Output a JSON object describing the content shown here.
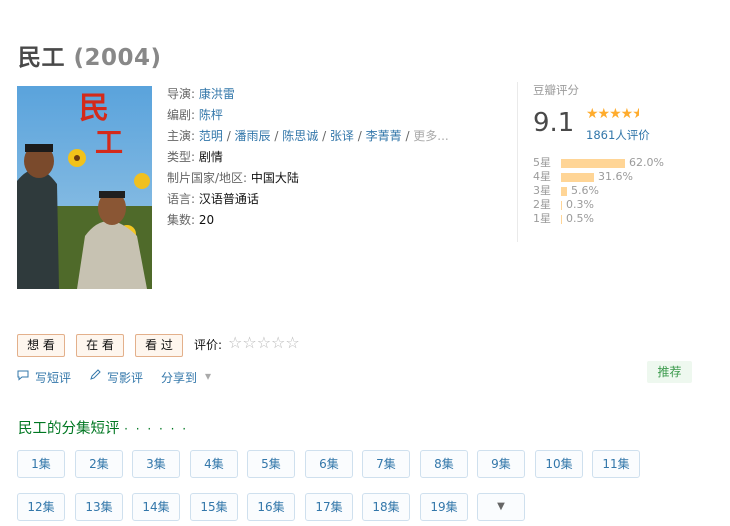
{
  "title": {
    "name": "民工",
    "year": "(2004)"
  },
  "info": {
    "director_label": "导演: ",
    "director": "康洪雷",
    "writer_label": "编剧: ",
    "writer": "陈枰",
    "cast_label": "主演: ",
    "cast": [
      "范明",
      "潘雨辰",
      "陈思诚",
      "张译",
      "李菁菁"
    ],
    "cast_sep": " / ",
    "cast_more": "更多...",
    "genre_label": "类型: ",
    "genre": "剧情",
    "country_label": "制片国家/地区: ",
    "country": "中国大陆",
    "language_label": "语言: ",
    "language": "汉语普通话",
    "episodes_label": "集数: ",
    "episodes": "20"
  },
  "rating": {
    "label": "豆瓣评分",
    "score": "9.1",
    "stars": 4.5,
    "count": "1861人评价",
    "distribution": [
      {
        "label": "5星",
        "percent": 62.0,
        "text": "62.0%"
      },
      {
        "label": "4星",
        "percent": 31.6,
        "text": "31.6%"
      },
      {
        "label": "3星",
        "percent": 5.6,
        "text": "5.6%"
      },
      {
        "label": "2星",
        "percent": 0.3,
        "text": "0.3%"
      },
      {
        "label": "1星",
        "percent": 0.5,
        "text": "0.5%"
      }
    ]
  },
  "actions": {
    "want": "想 看",
    "watching": "在 看",
    "watched": "看 过",
    "rate_label": "评价:",
    "rate_stars": "☆☆☆☆☆"
  },
  "subactions": {
    "short_review": "写短评",
    "long_review": "写影评",
    "share": "分享到",
    "share_arrow": "▾",
    "recommend": "推荐"
  },
  "episodes_section": {
    "title": "民工的分集短评",
    "dots": "· · · · · ·",
    "items": [
      "1集",
      "2集",
      "3集",
      "4集",
      "5集",
      "6集",
      "7集",
      "8集",
      "9集",
      "10集",
      "11集",
      "12集",
      "13集",
      "14集",
      "15集",
      "16集",
      "17集",
      "18集",
      "19集"
    ],
    "more": "▼"
  },
  "poster": {
    "caption": "民工"
  },
  "colors": {
    "link": "#3377aa",
    "green": "#007722",
    "star": "#ffac2d",
    "bar": "#ffd596"
  }
}
